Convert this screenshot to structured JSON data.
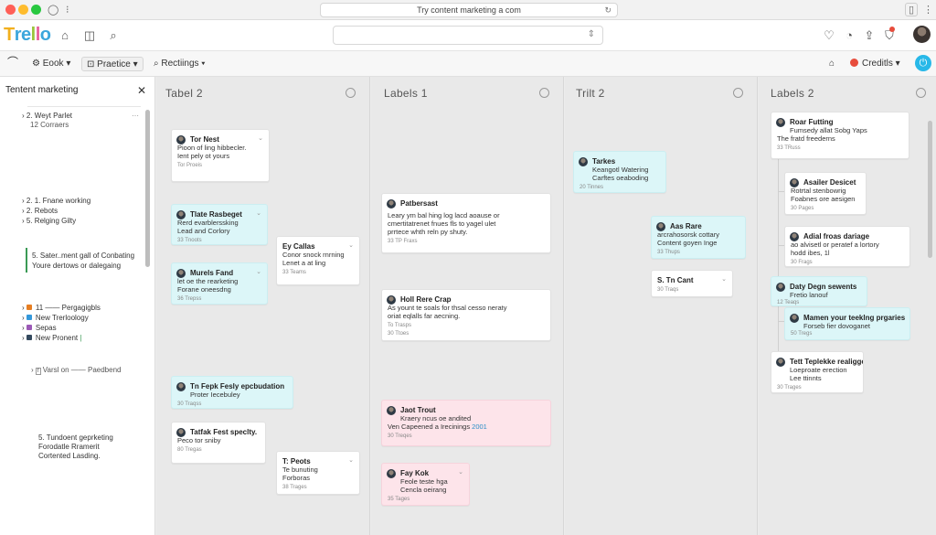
{
  "browser": {
    "url": "Try content marketing a com"
  },
  "app": {
    "logo": [
      "T",
      "r",
      "e",
      "l",
      "l",
      "o"
    ],
    "logo_colors": [
      "#f2b01e",
      "#3ba6dc",
      "#3ba6dc",
      "#9ac53c",
      "#e85d9a",
      "#3ba6dc"
    ]
  },
  "toolbar": {
    "book": "Eook",
    "practice": "Praetice",
    "rectings": "Rectiings",
    "credits": "Creditls"
  },
  "sidebar": {
    "title": "Tentent marketing",
    "lines": [
      "2. Weyt Parlet",
      "12 Corraers",
      "2. 1.  Fnane working",
      "2.  Rebots",
      "5.  Relging Gilty",
      "5. Sater..ment gall of Conbating",
      "Youre dertows or dalegaing",
      "11  ——  Pergagigbls",
      "New Trerloology",
      "Sepas",
      "New Pronent",
      "Varsl on  ——  Paedbend",
      "5.  Tundoent geprketing",
      "Forodatle Rramerit",
      "Cortented Lasding."
    ],
    "square_colors": [
      "#e67e22",
      "#3498db",
      "#9b59b6",
      "#34495e"
    ]
  },
  "columns": [
    {
      "title": "Tabel 2",
      "cards": [
        {
          "title": "Tor Nest",
          "lines": [
            "Pioon of ling hibbecler.",
            "Ient pely ot yours"
          ],
          "meta": "Tor Proeis",
          "color": "white"
        },
        {
          "title": "Tlate Rasbeget",
          "lines": [
            "Rerd evarblerssking",
            "Lead and Corlory"
          ],
          "meta": "33 Tnoots",
          "color": "cyan"
        },
        {
          "title": "Ey Callas",
          "lines": [
            "Conor snock rnrning",
            "Lenet a at ling"
          ],
          "meta": "33 Teams",
          "color": "white"
        },
        {
          "title": "Murels Fand",
          "lines": [
            "let oe the rearketing",
            "Forane oneesdng"
          ],
          "meta": "36 Trepss",
          "color": "cyan"
        },
        {
          "title": "Tn Fepk Fesly epcbudation",
          "lines": [
            "Proter Iecebuley"
          ],
          "meta": "30 Traqss",
          "color": "cyan"
        },
        {
          "title": "Tatfak Fest speclty.",
          "lines": [
            "Peco tor sniby"
          ],
          "meta": "80 Tregas",
          "color": "white"
        },
        {
          "title": "T: Peots",
          "lines": [
            "Te bunuting",
            "Forboras"
          ],
          "meta": "38 Trages",
          "color": "white"
        }
      ]
    },
    {
      "title": "Labels 1",
      "cards": [
        {
          "title": "Patbersast",
          "lines": [
            "Leary ym bal hing log lacd aoause or",
            "cmertitatrenet fnues fls to yagel ulet",
            "prrtece whth reln py shuty."
          ],
          "meta": "33 TP Fraxs",
          "color": "white"
        },
        {
          "title": "Holl Rere Crap",
          "lines": [
            "As yount te soals for thsal cesso neraty",
            "oriat eqlalls far aecning."
          ],
          "meta": "To Trasps",
          "meta2": "30 Ttoes",
          "color": "white"
        },
        {
          "title": "Jaot Trout",
          "lines": [
            "Kraery ncus oe andited"
          ],
          "line_prefix": "Ven Capeened a Irecinings ",
          "line_accent": "2001",
          "meta": "30 Treqes",
          "color": "pink"
        },
        {
          "title": "Fay Kok",
          "lines": [
            "Feole teste hga",
            "Cencla oeirang"
          ],
          "meta": "35 Tages",
          "color": "pink"
        }
      ]
    },
    {
      "title": "Trilt 2",
      "cards": [
        {
          "title": "Tarkes",
          "lines": [
            "Keangotl Watering",
            "Carftes oeaboding"
          ],
          "meta": "20 Tinnes",
          "color": "cyan"
        },
        {
          "title": "Aas Rare",
          "lines": [
            "arcrahosorsk cottary",
            "Content goyen Inge"
          ],
          "meta": "33 Thups",
          "color": "cyan"
        },
        {
          "title": "S. Tn Cant",
          "lines": [],
          "meta": "30 Traqs",
          "color": "white"
        }
      ]
    },
    {
      "title": "Labels 2",
      "cards": [
        {
          "title": "Roar Futting",
          "lines": [
            "Fumsedy allat Sobg Yaps",
            "The fratd freederns"
          ],
          "meta": "33 TRuss",
          "color": "white"
        },
        {
          "title": "Asailer Desicet",
          "lines": [
            "Rotrtal stenbowrig",
            "Foabnes ore aesigen"
          ],
          "meta": "30 Pages",
          "color": "white"
        },
        {
          "title": "Adial froas dariage",
          "lines": [
            "ao alvisetl or peratef a lortory",
            "hodd ibes, 1l"
          ],
          "meta": "30 Frags",
          "color": "white"
        },
        {
          "title": "Daty Degn sewents",
          "lines": [
            "Fretio lanouf"
          ],
          "meta": "12 Teaqs",
          "color": "cyan"
        },
        {
          "title": "Mamen your teeklng prgaries",
          "lines": [
            "Forseb fier dovoganet"
          ],
          "meta": "50 Tregs",
          "color": "cyan"
        },
        {
          "title": "Tett Teplekke realigge",
          "lines": [
            "Loeproate erection",
            "Lee ttinnts"
          ],
          "meta": "30 Trages",
          "color": "white"
        }
      ]
    }
  ]
}
